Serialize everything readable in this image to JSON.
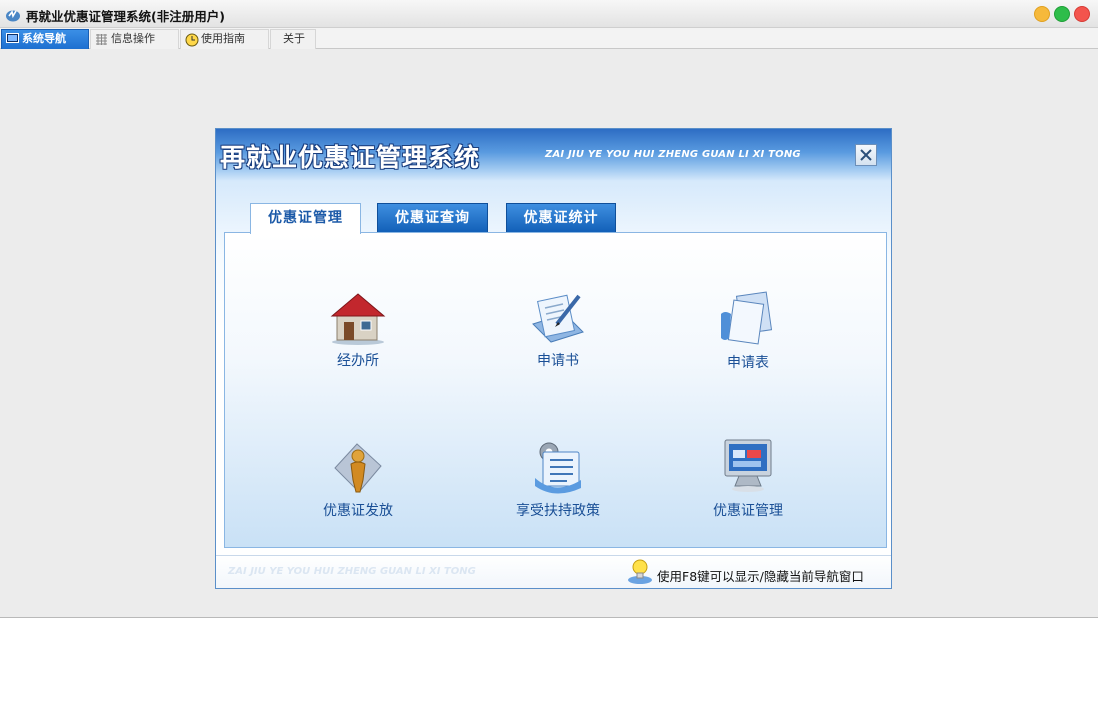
{
  "window": {
    "title": "再就业优惠证管理系统(非注册用户)"
  },
  "tabs": [
    {
      "label": "系统导航",
      "icon": "monitor-icon",
      "active": true
    },
    {
      "label": "信息操作",
      "icon": "grid-icon",
      "active": false
    },
    {
      "label": "使用指南",
      "icon": "clock-icon",
      "active": false
    },
    {
      "label": "关于",
      "icon": "",
      "active": false
    }
  ],
  "panel": {
    "title": "再就业优惠证管理系统",
    "subtitle": "ZAI JIU YE YOU HUI ZHENG GUAN LI XI TONG",
    "inner_tabs": [
      {
        "label": "优惠证管理",
        "active": true
      },
      {
        "label": "优惠证查询",
        "active": false
      },
      {
        "label": "优惠证统计",
        "active": false
      }
    ],
    "items": [
      {
        "label": "经办所",
        "icon": "house-icon"
      },
      {
        "label": "申请书",
        "icon": "document-pen-icon"
      },
      {
        "label": "申请表",
        "icon": "documents-icon"
      },
      {
        "label": "优惠证发放",
        "icon": "person-icon"
      },
      {
        "label": "享受扶持政策",
        "icon": "settings-document-icon"
      },
      {
        "label": "优惠证管理",
        "icon": "computer-monitor-icon"
      }
    ],
    "footer_subtitle": "ZAI JIU YE YOU HUI ZHENG GUAN LI XI TONG",
    "footer_hint": "使用F8键可以显示/隐藏当前导航窗口"
  },
  "colors": {
    "accent": "#1d6fd0",
    "panel_border": "#5a8fc9",
    "text_blue": "#1a4f96"
  }
}
